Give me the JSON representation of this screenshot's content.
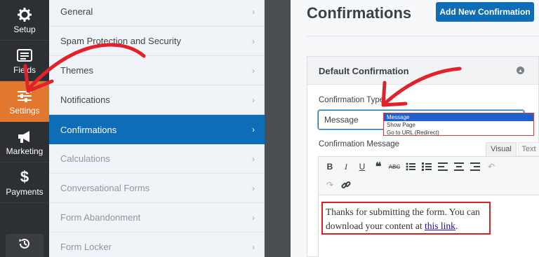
{
  "sidebar": {
    "items": [
      {
        "label": "Setup",
        "icon": "gear-icon"
      },
      {
        "label": "Fields",
        "icon": "fields-icon"
      },
      {
        "label": "Settings",
        "icon": "sliders-icon",
        "active": true
      },
      {
        "label": "Marketing",
        "icon": "megaphone-icon"
      },
      {
        "label": "Payments",
        "icon": "dollar-icon"
      }
    ],
    "bottom_icon": "history-icon"
  },
  "settings_nav": {
    "items": [
      {
        "label": "General"
      },
      {
        "label": "Spam Protection and Security"
      },
      {
        "label": "Themes"
      },
      {
        "label": "Notifications"
      },
      {
        "label": "Confirmations",
        "active": true
      },
      {
        "label": "Calculations"
      },
      {
        "label": "Conversational Forms"
      },
      {
        "label": "Form Abandonment"
      },
      {
        "label": "Form Locker"
      }
    ]
  },
  "main": {
    "title": "Confirmations",
    "add_button": "Add New Confirmation",
    "card": {
      "title": "Default Confirmation",
      "type_label": "Confirmation Type",
      "type_value": "Message",
      "type_options": [
        "Message",
        "Show Page",
        "Go to URL (Redirect)"
      ],
      "message_label": "Confirmation Message",
      "editor_tabs": {
        "visual": "Visual",
        "text": "Text"
      },
      "message_text": "Thanks for submitting the form. You can download your content at ",
      "message_link": "this link",
      "message_end": "."
    }
  },
  "colors": {
    "accent": "#0e6db7",
    "active_rail": "#e27730",
    "rail_bg": "#2c2f33",
    "annotation_red": "#e2222a"
  }
}
